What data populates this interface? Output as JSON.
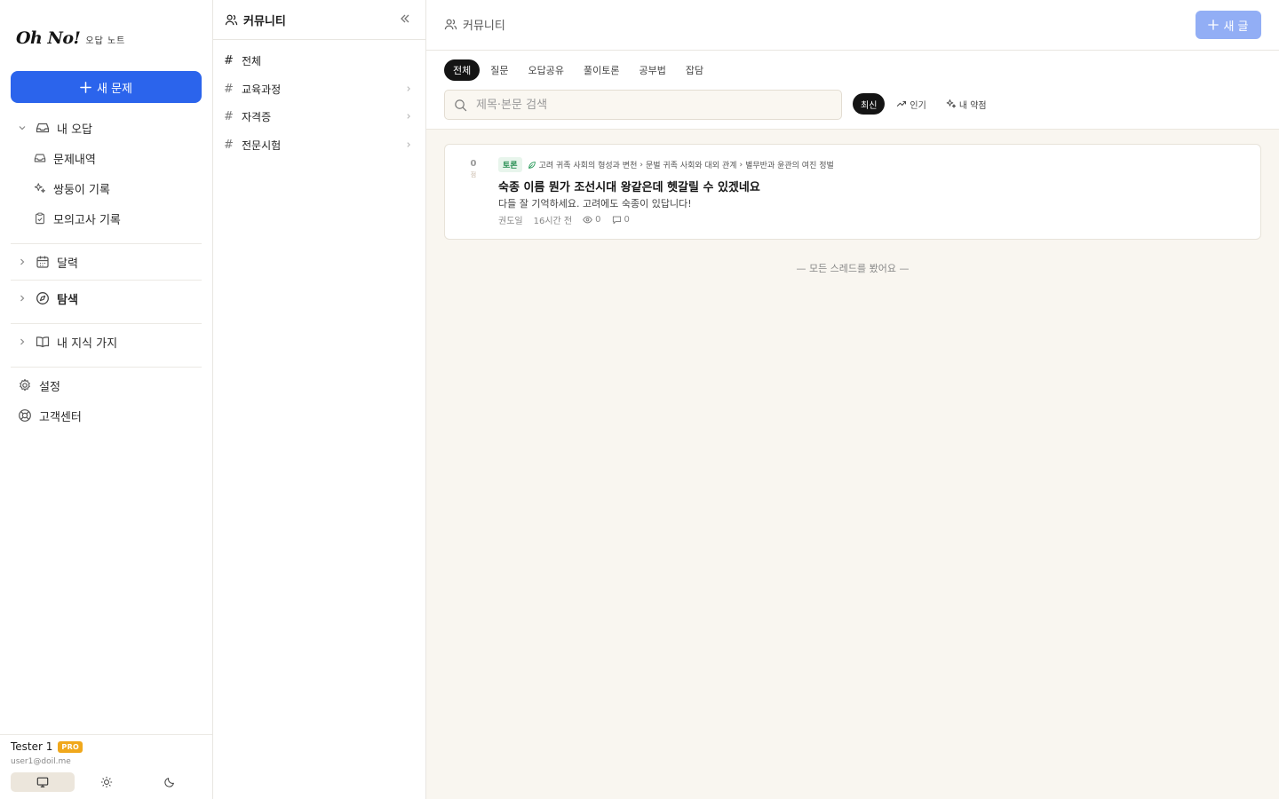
{
  "sidebar": {
    "logo_main": "Oh No!",
    "logo_sub": "오답 노트",
    "new_problem_label": "새 문제",
    "my_wrong_answers": "내 오답",
    "problem_history": "문제내역",
    "twin_records": "쌍둥이 기록",
    "mock_exam_records": "모의고사 기록",
    "calendar": "달력",
    "explore": "탐색",
    "knowledge_branch": "내 지식 가지",
    "settings": "설정",
    "support": "고객센터"
  },
  "user": {
    "name": "Tester 1",
    "badge": "PRO",
    "email": "user1@doil.me"
  },
  "channels": {
    "title": "커뮤니티",
    "items": [
      {
        "label": "전체"
      },
      {
        "label": "교육과정"
      },
      {
        "label": "자격증"
      },
      {
        "label": "전문시험"
      }
    ]
  },
  "main": {
    "title": "커뮤니티",
    "write_label": "새 글",
    "tabs": [
      {
        "label": "전체"
      },
      {
        "label": "질문"
      },
      {
        "label": "오답공유"
      },
      {
        "label": "풀이토론"
      },
      {
        "label": "공부법"
      },
      {
        "label": "잡담"
      }
    ],
    "search_placeholder": "제목·본문 검색",
    "sorts": [
      {
        "label": "최신"
      },
      {
        "label": "인기"
      },
      {
        "label": "내 약점"
      }
    ],
    "end_note": "— 모든 스레드를 봤어요 —"
  },
  "thread": {
    "votes": "0",
    "vote_unit": "점",
    "tag": "토론",
    "breadcrumb": [
      "고려 귀족 사회의 형성과 변천",
      "문벌 귀족 사회와 대외 관계",
      "별무반과 윤관의 여진 정벌"
    ],
    "title": "숙종 이름 뭔가 조선시대 왕같은데 헷갈릴 수 있겠네요",
    "excerpt": "다들 잘 기억하세요. 고려에도 숙종이 있답니다!",
    "author": "권도일",
    "time": "16시간 전",
    "views": "0",
    "comments": "0"
  },
  "colors": {
    "primary": "#2b64ec",
    "primary_disabled": "#92aef5",
    "pro_badge": "#f0a81c",
    "tag_green": "#1f8a4c",
    "background": "#f9f6f0"
  }
}
